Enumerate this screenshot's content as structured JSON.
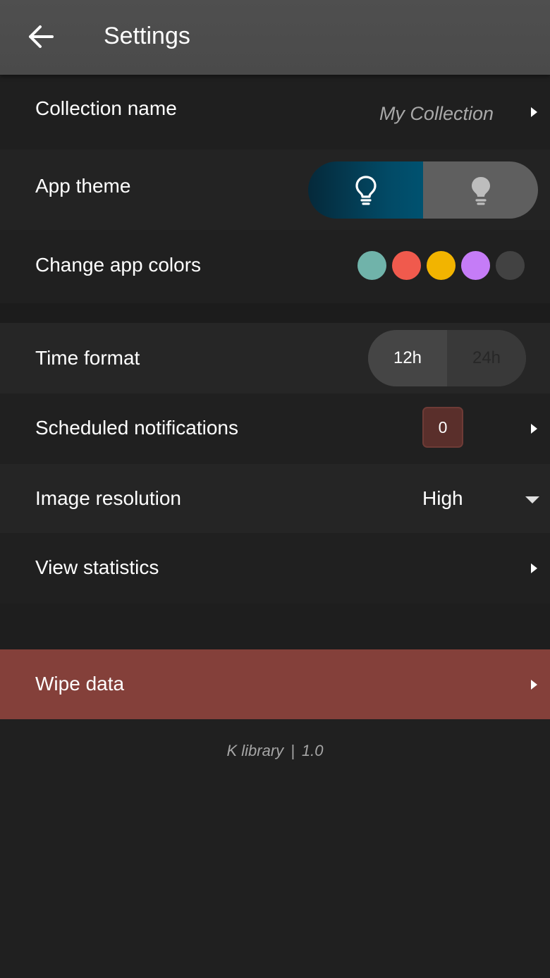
{
  "header": {
    "title": "Settings",
    "back_icon": "arrow-left-icon"
  },
  "settings": {
    "collection_name": {
      "label": "Collection name",
      "value": "My Collection"
    },
    "app_theme": {
      "label": "App theme",
      "options": [
        "dark",
        "light"
      ],
      "selected": "dark",
      "dark_icon": "lightbulb-outline-icon",
      "light_icon": "lightbulb-filled-icon"
    },
    "app_colors": {
      "label": "Change app colors",
      "swatches": [
        "#70b3aa",
        "#f05a4d",
        "#f2b400",
        "#c57cf7",
        "#424242"
      ]
    },
    "time_format": {
      "label": "Time format",
      "options": [
        "12h",
        "24h"
      ],
      "selected": "12h"
    },
    "scheduled_notifications": {
      "label": "Scheduled notifications",
      "count": "0"
    },
    "image_resolution": {
      "label": "Image resolution",
      "value": "High"
    },
    "view_statistics": {
      "label": "View statistics"
    },
    "wipe_data": {
      "label": "Wipe data",
      "color": "#84403a"
    }
  },
  "footer": {
    "app_name": "K library",
    "separator": "|",
    "version": "1.0"
  },
  "colors": {
    "background": "#202020",
    "header": "#4d4d4d",
    "theme_dark_accent": "#024a66"
  }
}
